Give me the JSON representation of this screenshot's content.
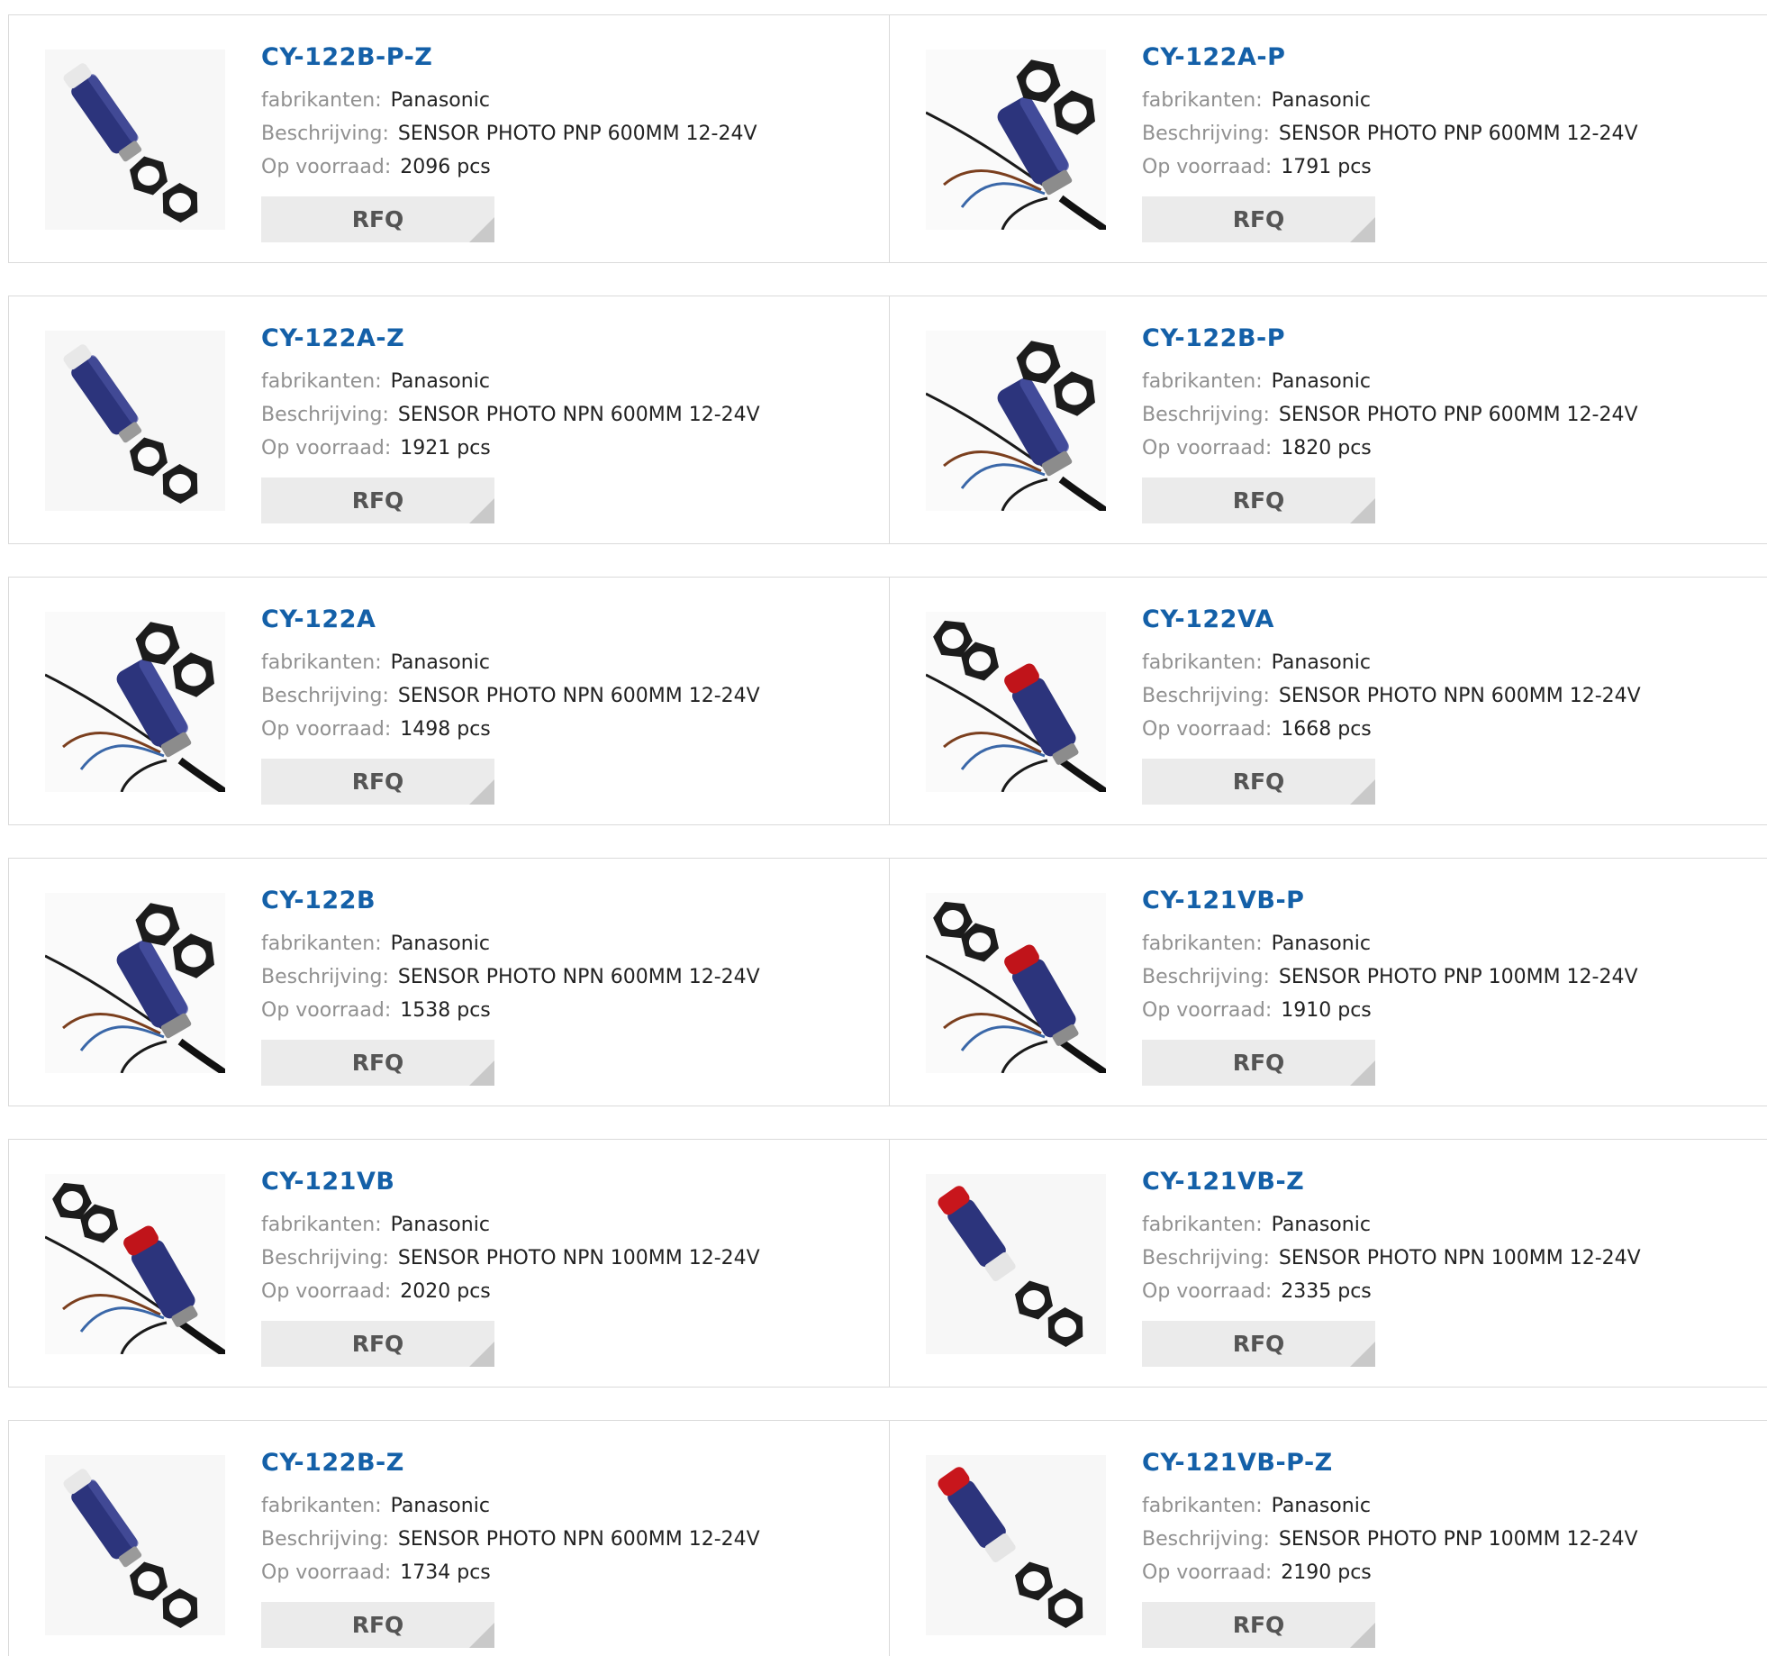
{
  "labels": {
    "manufacturer": "fabrikanten:",
    "description": "Beschrijving:",
    "stock": "Op voorraad:",
    "rfq": "RFQ"
  },
  "colors": {
    "part_number": "#1460a8",
    "label": "#909090",
    "button_bg": "#ebebeb"
  },
  "products": [
    {
      "pn": "CY-122B-P-Z",
      "manufacturer": "Panasonic",
      "description": "SENSOR PHOTO PNP 600MM 12-24V",
      "stock": "2096 pcs",
      "image": "sensor-with-nuts-clear-lens"
    },
    {
      "pn": "CY-122A-P",
      "manufacturer": "Panasonic",
      "description": "SENSOR PHOTO PNP 600MM 12-24V",
      "stock": "1791 pcs",
      "image": "sensor-with-cable"
    },
    {
      "pn": "CY-122A-Z",
      "manufacturer": "Panasonic",
      "description": "SENSOR PHOTO NPN 600MM 12-24V",
      "stock": "1921 pcs",
      "image": "sensor-with-nuts-clear-lens"
    },
    {
      "pn": "CY-122B-P",
      "manufacturer": "Panasonic",
      "description": "SENSOR PHOTO PNP 600MM 12-24V",
      "stock": "1820 pcs",
      "image": "sensor-with-cable"
    },
    {
      "pn": "CY-122A",
      "manufacturer": "Panasonic",
      "description": "SENSOR PHOTO NPN 600MM 12-24V",
      "stock": "1498 pcs",
      "image": "sensor-with-cable"
    },
    {
      "pn": "CY-122VA",
      "manufacturer": "Panasonic",
      "description": "SENSOR PHOTO NPN 600MM 12-24V",
      "stock": "1668 pcs",
      "image": "sensor-red-lens-with-cable"
    },
    {
      "pn": "CY-122B",
      "manufacturer": "Panasonic",
      "description": "SENSOR PHOTO NPN 600MM 12-24V",
      "stock": "1538 pcs",
      "image": "sensor-with-cable"
    },
    {
      "pn": "CY-121VB-P",
      "manufacturer": "Panasonic",
      "description": "SENSOR PHOTO PNP 100MM 12-24V",
      "stock": "1910 pcs",
      "image": "sensor-red-lens-with-cable"
    },
    {
      "pn": "CY-121VB",
      "manufacturer": "Panasonic",
      "description": "SENSOR PHOTO NPN 100MM 12-24V",
      "stock": "2020 pcs",
      "image": "sensor-red-lens-with-cable"
    },
    {
      "pn": "CY-121VB-Z",
      "manufacturer": "Panasonic",
      "description": "SENSOR PHOTO NPN 100MM 12-24V",
      "stock": "2335 pcs",
      "image": "sensor-red-lens-with-nuts"
    },
    {
      "pn": "CY-122B-Z",
      "manufacturer": "Panasonic",
      "description": "SENSOR PHOTO NPN 600MM 12-24V",
      "stock": "1734 pcs",
      "image": "sensor-with-nuts-clear-lens"
    },
    {
      "pn": "CY-121VB-P-Z",
      "manufacturer": "Panasonic",
      "description": "SENSOR PHOTO PNP 100MM 12-24V",
      "stock": "2190 pcs",
      "image": "sensor-red-lens-with-nuts"
    }
  ]
}
